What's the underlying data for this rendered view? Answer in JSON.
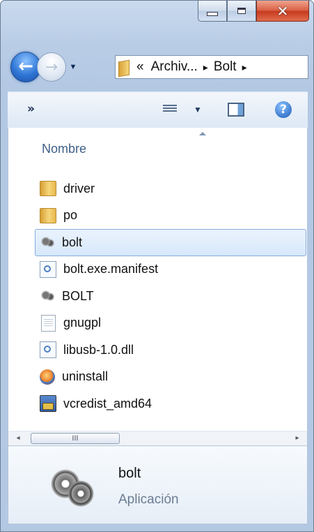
{
  "window": {
    "caption_buttons": {
      "minimize": "minimize",
      "maximize": "maximize",
      "close": "close"
    }
  },
  "navigation": {
    "back_arrow": "←",
    "forward_arrow": "→",
    "history_caret": "▼"
  },
  "address_bar": {
    "overflow": "«",
    "crumbs": [
      "Archiv...",
      "Bolt"
    ],
    "separator": "▸"
  },
  "toolbar": {
    "overflow_chevron": "»",
    "views_caret": "▼",
    "help_glyph": "?"
  },
  "list_header": {
    "column_name": "Nombre"
  },
  "files": [
    {
      "name": "driver",
      "icon": "folder-icon"
    },
    {
      "name": "po",
      "icon": "folder-icon"
    },
    {
      "name": "bolt",
      "icon": "application-icon",
      "selected": true
    },
    {
      "name": "bolt.exe.manifest",
      "icon": "config-file-icon"
    },
    {
      "name": "BOLT",
      "icon": "application-icon"
    },
    {
      "name": "gnugpl",
      "icon": "text-document-icon"
    },
    {
      "name": "libusb-1.0.dll",
      "icon": "config-file-icon"
    },
    {
      "name": "uninstall",
      "icon": "setup-icon"
    },
    {
      "name": "vcredist_amd64",
      "icon": "installer-icon"
    }
  ],
  "scrollbar": {
    "left_arrow": "◂",
    "thumb_grip": "III",
    "right_arrow": "▸"
  },
  "details_pane": {
    "name": "bolt",
    "type": "Aplicación"
  },
  "colors": {
    "selection_bg": "#d7e8fb",
    "selection_border": "#84acdd",
    "header_text": "#3f5f86",
    "close_button": "#c6391d"
  }
}
